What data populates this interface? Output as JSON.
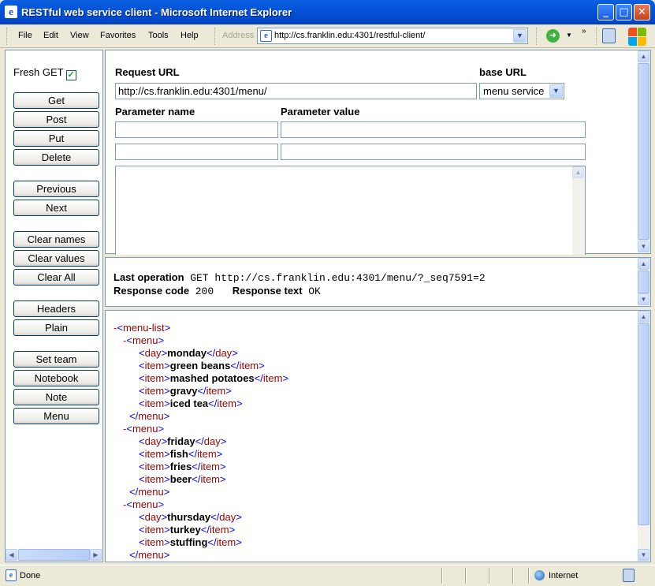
{
  "window": {
    "title": "RESTful web service client - Microsoft Internet Explorer"
  },
  "menubar": {
    "items": [
      "File",
      "Edit",
      "View",
      "Favorites",
      "Tools",
      "Help"
    ]
  },
  "address": {
    "label": "Address",
    "url": "http://cs.franklin.edu:4301/restful-client/"
  },
  "sidebar": {
    "fresh_get_label": "Fresh GET",
    "fresh_get_checked": true,
    "buttons": [
      "Get",
      "Post",
      "Put",
      "Delete",
      "Previous",
      "Next",
      "Clear names",
      "Clear values",
      "Clear All",
      "Headers",
      "Plain",
      "Set team",
      "Notebook",
      "Note",
      "Menu"
    ]
  },
  "request": {
    "url_label": "Request URL",
    "url_value": "http://cs.franklin.edu:4301/menu/",
    "base_label": "base URL",
    "base_selected": "menu service",
    "param_name_label": "Parameter name",
    "param_value_label": "Parameter value"
  },
  "result": {
    "last_op_label": "Last operation",
    "last_op_value": "GET http://cs.franklin.edu:4301/menu/?_seq7591=2",
    "response_code_label": "Response code",
    "response_code_value": "200",
    "response_text_label": "Response text",
    "response_text_value": "OK"
  },
  "xml": {
    "root_tag": "menu-list",
    "menus": [
      {
        "tag": "menu",
        "day": "monday",
        "items": [
          "green beans",
          "mashed potatoes",
          "gravy",
          "iced tea"
        ]
      },
      {
        "tag": "menu",
        "day": "friday",
        "items": [
          "fish",
          "fries",
          "beer"
        ]
      },
      {
        "tag": "menu",
        "day": "thursday",
        "items": [
          "turkey",
          "stuffing"
        ]
      }
    ],
    "day_tag": "day",
    "item_tag": "item"
  },
  "statusbar": {
    "status": "Done",
    "zone": "Internet"
  }
}
